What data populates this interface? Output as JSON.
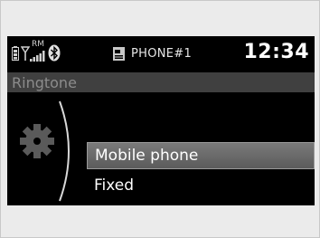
{
  "status_bar": {
    "icons": [
      "battery-icon",
      "signal-icon",
      "bluetooth-icon",
      "phone-icon"
    ],
    "roaming": "RM",
    "phone_name": "PHONE#1",
    "clock": "12:34"
  },
  "title": "Ringtone",
  "menu": {
    "items": [
      {
        "label": "Mobile phone",
        "selected": true
      },
      {
        "label": "Fixed",
        "selected": false
      }
    ]
  },
  "colors": {
    "screen_bg": "#000000",
    "title_bar_bg": "#404040",
    "selection": "#6a6a6a",
    "frame": "#ebebeb"
  }
}
